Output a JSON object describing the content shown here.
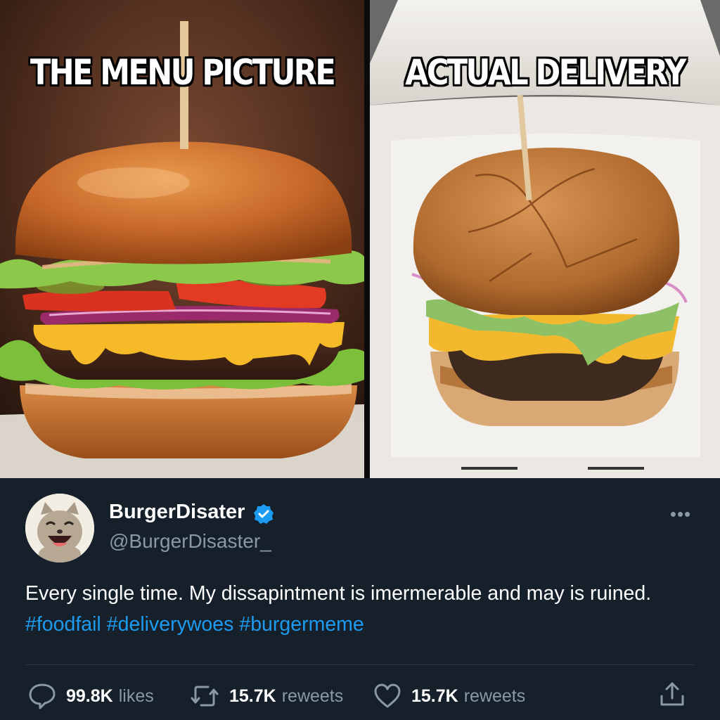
{
  "meme": {
    "left_caption": "THE MENU PICTURE",
    "right_caption": "ACTUAL DELIVERY"
  },
  "tweet": {
    "display_name": "BurgerDisater",
    "handle": "@BurgerDisaster_",
    "verified": true,
    "text": "Every single time. My dissapintment is imermerable and may is ruined.",
    "hashtags": [
      "#foodfail",
      "#deliverywoes",
      "#burgermeme"
    ],
    "actions": [
      {
        "icon": "reply-bubble-icon",
        "count": "99.8K",
        "label": "likes"
      },
      {
        "icon": "retweet-icon",
        "count": "15.7K",
        "label": "reweets"
      },
      {
        "icon": "heart-icon",
        "count": "15.7K",
        "label": "reweets"
      }
    ],
    "share_icon": "share-icon",
    "more_icon": "more-dots-icon"
  },
  "colors": {
    "background": "#15202b",
    "link": "#1d9bf0",
    "muted": "#8b98a5",
    "verified": "#1d9bf0"
  }
}
